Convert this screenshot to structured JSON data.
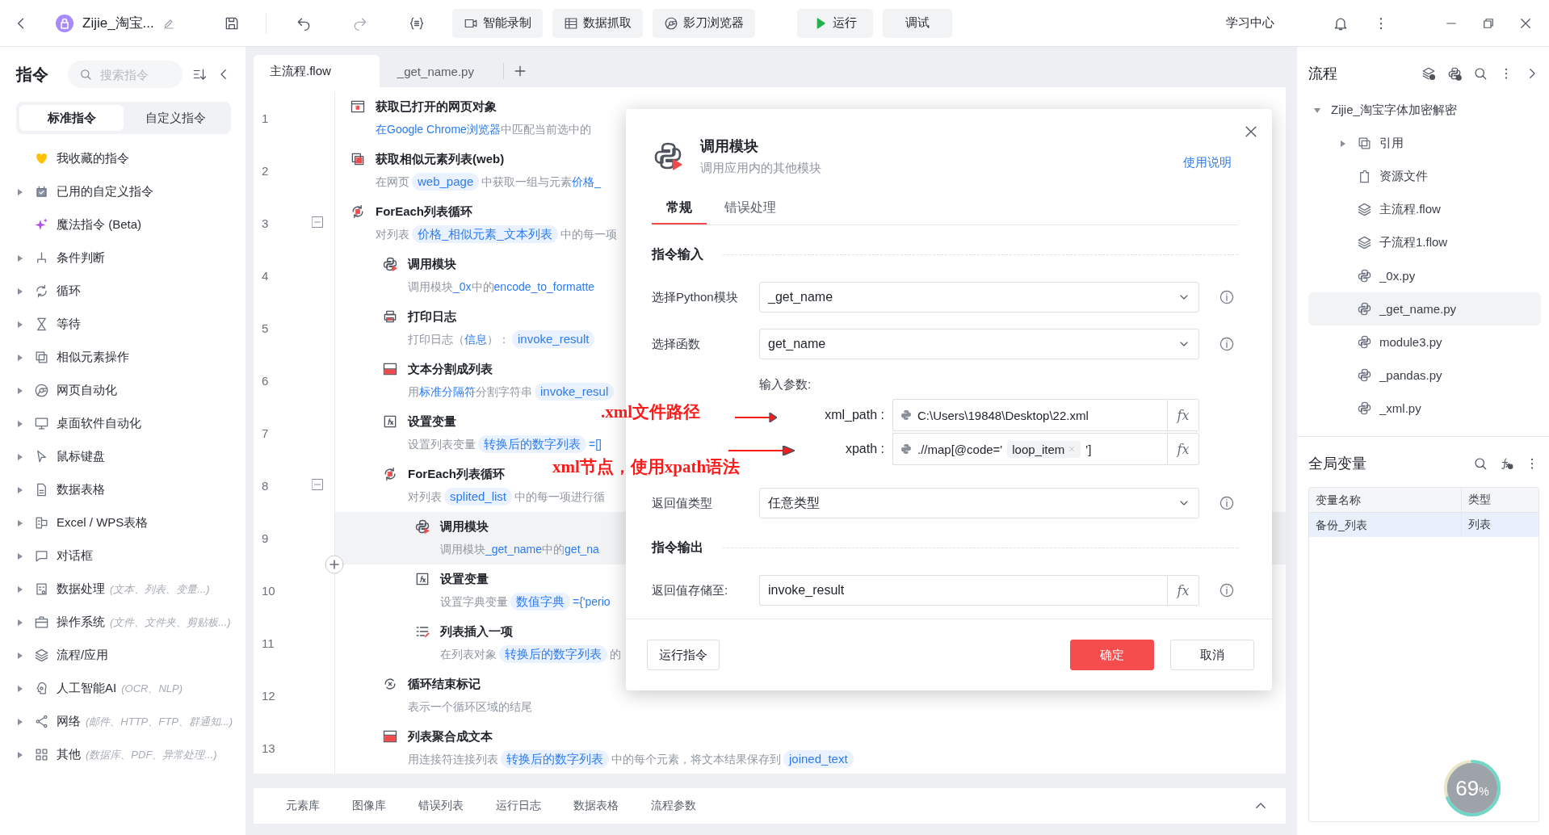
{
  "toolbar": {
    "title": "Zijie_淘宝...",
    "buttons": [
      {
        "kind": "record",
        "label": "智能录制"
      },
      {
        "kind": "capture",
        "label": "数据抓取"
      },
      {
        "kind": "browser",
        "label": "影刀浏览器"
      },
      {
        "kind": "run",
        "label": "运行"
      },
      {
        "kind": "debug",
        "label": "调试"
      }
    ],
    "help": "学习中心"
  },
  "sidebar": {
    "title": "指令",
    "search_placeholder": "搜索指令",
    "tabs": [
      {
        "label": "标准指令",
        "selected": true
      },
      {
        "label": "自定义指令",
        "selected": false
      }
    ],
    "items": [
      {
        "kind": "heart",
        "label": "我收藏的指令",
        "expandable": false
      },
      {
        "kind": "custom",
        "label": "已用的自定义指令",
        "expandable": true
      },
      {
        "kind": "magic",
        "label": "魔法指令 (Beta)",
        "expandable": false
      },
      {
        "kind": "branch",
        "label": "条件判断",
        "expandable": true
      },
      {
        "kind": "loop",
        "label": "循环",
        "expandable": true
      },
      {
        "kind": "wait",
        "label": "等待",
        "expandable": true
      },
      {
        "kind": "similar",
        "label": "相似元素操作",
        "expandable": true
      },
      {
        "kind": "web",
        "label": "网页自动化",
        "expandable": true
      },
      {
        "kind": "desktop",
        "label": "桌面软件自动化",
        "expandable": true
      },
      {
        "kind": "cursor",
        "label": "鼠标键盘",
        "expandable": true
      },
      {
        "kind": "sheet",
        "label": "数据表格",
        "expandable": true
      },
      {
        "kind": "excel",
        "label": "Excel / WPS表格",
        "expandable": true
      },
      {
        "kind": "dialog",
        "label": "对话框",
        "expandable": true
      },
      {
        "kind": "data",
        "label": "数据处理",
        "hint": "(文本、列表、变量...)",
        "expandable": true
      },
      {
        "kind": "system",
        "label": "操作系统",
        "hint": "(文件、文件夹、剪贴板...)",
        "expandable": true
      },
      {
        "kind": "layers",
        "label": "流程/应用",
        "expandable": true
      },
      {
        "kind": "ai",
        "label": "人工智能AI",
        "hint": "(OCR、NLP)",
        "expandable": true
      },
      {
        "kind": "network",
        "label": "网络",
        "hint": "(邮件、HTTP、FTP、群通知...)",
        "expandable": true
      },
      {
        "kind": "grid",
        "label": "其他",
        "hint": "(数据库、PDF、异常处理...)",
        "expandable": true
      }
    ]
  },
  "editor_tabs": [
    {
      "label": "主流程.flow",
      "selected": true
    },
    {
      "label": "_get_name.py",
      "selected": false
    }
  ],
  "flow": {
    "steps": [
      {
        "number": "1",
        "kind": "webpage",
        "title": "获取已打开的网页对象",
        "selected": false,
        "desc": [
          {
            "kind": "link",
            "text": "在Google Chrome浏览器"
          },
          {
            "kind": "plain",
            "text": "中匹配当前选中的"
          }
        ]
      },
      {
        "number": "2",
        "kind": "similar",
        "title": "获取相似元素列表(web)",
        "selected": false,
        "desc": [
          {
            "kind": "plain",
            "text": "在网页"
          },
          {
            "kind": "token",
            "text": "web_page"
          },
          {
            "kind": "plain",
            "text": "中获取一组与元素"
          },
          {
            "kind": "link",
            "text": "价格_"
          }
        ]
      },
      {
        "number": "3",
        "kind": "loop",
        "title": "ForEach列表循环",
        "selected": false,
        "expanded": true,
        "desc": [
          {
            "kind": "plain",
            "text": "对列表"
          },
          {
            "kind": "token",
            "text": "价格_相似元素_文本列表"
          },
          {
            "kind": "plain",
            "text": "中的每一项"
          }
        ],
        "children": [
          {
            "number": "4",
            "kind": "python",
            "title": "调用模块",
            "selected": false,
            "desc": [
              {
                "kind": "plain",
                "text": "调用模块"
              },
              {
                "kind": "link",
                "text": "_0x"
              },
              {
                "kind": "plain",
                "text": "中的"
              },
              {
                "kind": "link",
                "text": "encode_to_formatte"
              }
            ]
          },
          {
            "number": "5",
            "kind": "print",
            "title": "打印日志",
            "selected": false,
            "desc": [
              {
                "kind": "plain",
                "text": "打印日志（"
              },
              {
                "kind": "link",
                "text": "信息"
              },
              {
                "kind": "plain",
                "text": "）："
              },
              {
                "kind": "token",
                "text": "invoke_result"
              }
            ]
          },
          {
            "number": "6",
            "kind": "split",
            "title": "文本分割成列表",
            "selected": false,
            "desc": [
              {
                "kind": "plain",
                "text": "用"
              },
              {
                "kind": "link",
                "text": "标准分隔符"
              },
              {
                "kind": "plain",
                "text": "分割字符串"
              },
              {
                "kind": "token",
                "text": "invoke_resul"
              }
            ]
          },
          {
            "number": "7",
            "kind": "variable",
            "title": "设置变量",
            "selected": false,
            "desc": [
              {
                "kind": "plain",
                "text": "设置列表变量"
              },
              {
                "kind": "token",
                "text": "转换后的数字列表"
              },
              {
                "kind": "link",
                "text": "=[]"
              }
            ]
          },
          {
            "number": "8",
            "kind": "loop",
            "title": "ForEach列表循环",
            "selected": false,
            "expanded": true,
            "desc": [
              {
                "kind": "plain",
                "text": "对列表"
              },
              {
                "kind": "token",
                "text": "splited_list"
              },
              {
                "kind": "plain",
                "text": "中的每一项进行循"
              }
            ],
            "children": [
              {
                "number": "9",
                "kind": "python",
                "title": "调用模块",
                "selected": true,
                "desc": [
                  {
                    "kind": "plain",
                    "text": "调用模块"
                  },
                  {
                    "kind": "link",
                    "text": "_get_name"
                  },
                  {
                    "kind": "plain",
                    "text": "中的"
                  },
                  {
                    "kind": "link",
                    "text": "get_na"
                  }
                ]
              },
              {
                "number": "10",
                "kind": "variable",
                "title": "设置变量",
                "selected": false,
                "desc": [
                  {
                    "kind": "plain",
                    "text": "设置字典变量"
                  },
                  {
                    "kind": "token",
                    "text": "数值字典"
                  },
                  {
                    "kind": "link",
                    "text": "={'perio"
                  }
                ]
              },
              {
                "number": "11",
                "kind": "insert",
                "title": "列表插入一项",
                "selected": false,
                "desc": [
                  {
                    "kind": "plain",
                    "text": "在列表对象"
                  },
                  {
                    "kind": "token",
                    "text": "转换后的数字列表"
                  },
                  {
                    "kind": "plain",
                    "text": "的"
                  }
                ]
              }
            ]
          },
          {
            "number": "12",
            "kind": "loopend",
            "title": "循环结束标记",
            "selected": false,
            "desc": [
              {
                "kind": "plain",
                "text": "表示一个循环区域的结尾"
              }
            ]
          },
          {
            "number": "13",
            "kind": "join",
            "title": "列表聚合成文本",
            "selected": false,
            "desc": [
              {
                "kind": "plain",
                "text": "用连接符连接列表"
              },
              {
                "kind": "token",
                "text": "转换后的数字列表"
              },
              {
                "kind": "plain",
                "text": "中的每个元素，将文本结果保存到"
              },
              {
                "kind": "token",
                "text": "joined_text"
              }
            ]
          }
        ]
      }
    ]
  },
  "bottom_tabs": [
    "元素库",
    "图像库",
    "错误列表",
    "运行日志",
    "数据表格",
    "流程参数"
  ],
  "dialog": {
    "title": "调用模块",
    "subtitle": "调用应用内的其他模块",
    "help_link": "使用说明",
    "tabs": [
      {
        "label": "常规",
        "selected": true
      },
      {
        "label": "错误处理",
        "selected": false
      }
    ],
    "input_section": "指令输入",
    "fields": [
      {
        "kind": "select",
        "label": "选择Python模块",
        "value": "_get_name"
      },
      {
        "kind": "select",
        "label": "选择函数",
        "value": "get_name"
      }
    ],
    "params_label": "输入参数:",
    "params": [
      {
        "name": "xml_path :",
        "fx": "fx",
        "value": [
          {
            "kind": "text",
            "text": "C:\\Users\\19848\\Desktop\\22.xml"
          }
        ]
      },
      {
        "name": "xpath :",
        "fx": "fx",
        "value": [
          {
            "kind": "text",
            "text": ".//map[@code='"
          },
          {
            "kind": "chip",
            "text": "loop_item"
          },
          {
            "kind": "text",
            "text": "']"
          }
        ]
      }
    ],
    "return_type": {
      "kind": "select",
      "label": "返回值类型",
      "value": "任意类型"
    },
    "output_section": "指令输出",
    "output": {
      "kind": "input",
      "label": "返回值存储至:",
      "value": "invoke_result",
      "fx": "fx"
    },
    "buttons": [
      {
        "kind": "secondary",
        "label": "运行指令"
      },
      {
        "kind": "primary",
        "label": "确定"
      },
      {
        "kind": "default",
        "label": "取消"
      }
    ]
  },
  "annotations": [
    {
      "text": ".xml文件路径"
    },
    {
      "text": "xml节点，使用xpath语法"
    }
  ],
  "project": {
    "title": "流程",
    "root": {
      "label": "Zijie_淘宝字体加密解密",
      "expanded": true,
      "children": [
        {
          "kind": "reference",
          "label": "引用",
          "expandable": true,
          "selected": false
        },
        {
          "kind": "resource",
          "label": "资源文件",
          "expandable": false,
          "selected": false
        },
        {
          "kind": "flow",
          "label": "主流程.flow",
          "expandable": false,
          "selected": false
        },
        {
          "kind": "flow",
          "label": "子流程1.flow",
          "expandable": false,
          "selected": false
        },
        {
          "kind": "python",
          "label": "_0x.py",
          "expandable": false,
          "selected": false
        },
        {
          "kind": "python",
          "label": "_get_name.py",
          "expandable": false,
          "selected": true
        },
        {
          "kind": "python",
          "label": "module3.py",
          "expandable": false,
          "selected": false
        },
        {
          "kind": "python",
          "label": "_pandas.py",
          "expandable": false,
          "selected": false
        },
        {
          "kind": "python",
          "label": "_xml.py",
          "expandable": false,
          "selected": false
        }
      ]
    }
  },
  "variables": {
    "title": "全局变量",
    "columns": [
      "变量名称",
      "类型"
    ],
    "rows": [
      {
        "cells": [
          "备份_列表",
          "列表"
        ],
        "selected": true
      }
    ]
  },
  "gauge": {
    "value": "69",
    "unit": "%",
    "level": 0.69
  }
}
